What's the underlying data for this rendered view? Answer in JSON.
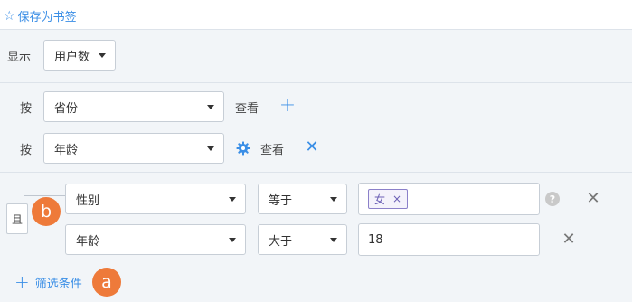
{
  "topbar": {
    "bookmark_icon": "star-icon",
    "bookmark_label": "保存为书签"
  },
  "display": {
    "label": "显示",
    "metric": "用户数"
  },
  "group_by": {
    "rows": [
      {
        "label": "按",
        "field": "省份",
        "action": "查看"
      },
      {
        "label": "按",
        "field": "年龄",
        "action": "查看"
      }
    ]
  },
  "filter": {
    "relation": "且",
    "conditions": [
      {
        "field": "性别",
        "operator": "等于",
        "tag_value": "女",
        "tag_remove": "×"
      },
      {
        "field": "年龄",
        "operator": "大于",
        "value": "18"
      }
    ],
    "add_label": "筛选条件",
    "help_mark": "?"
  },
  "annotations": {
    "badge_a": "a",
    "badge_b": "b"
  },
  "colors": {
    "accent": "#3a8ee6",
    "badge": "#ee7a3a",
    "tag_border": "#8b80c9"
  }
}
